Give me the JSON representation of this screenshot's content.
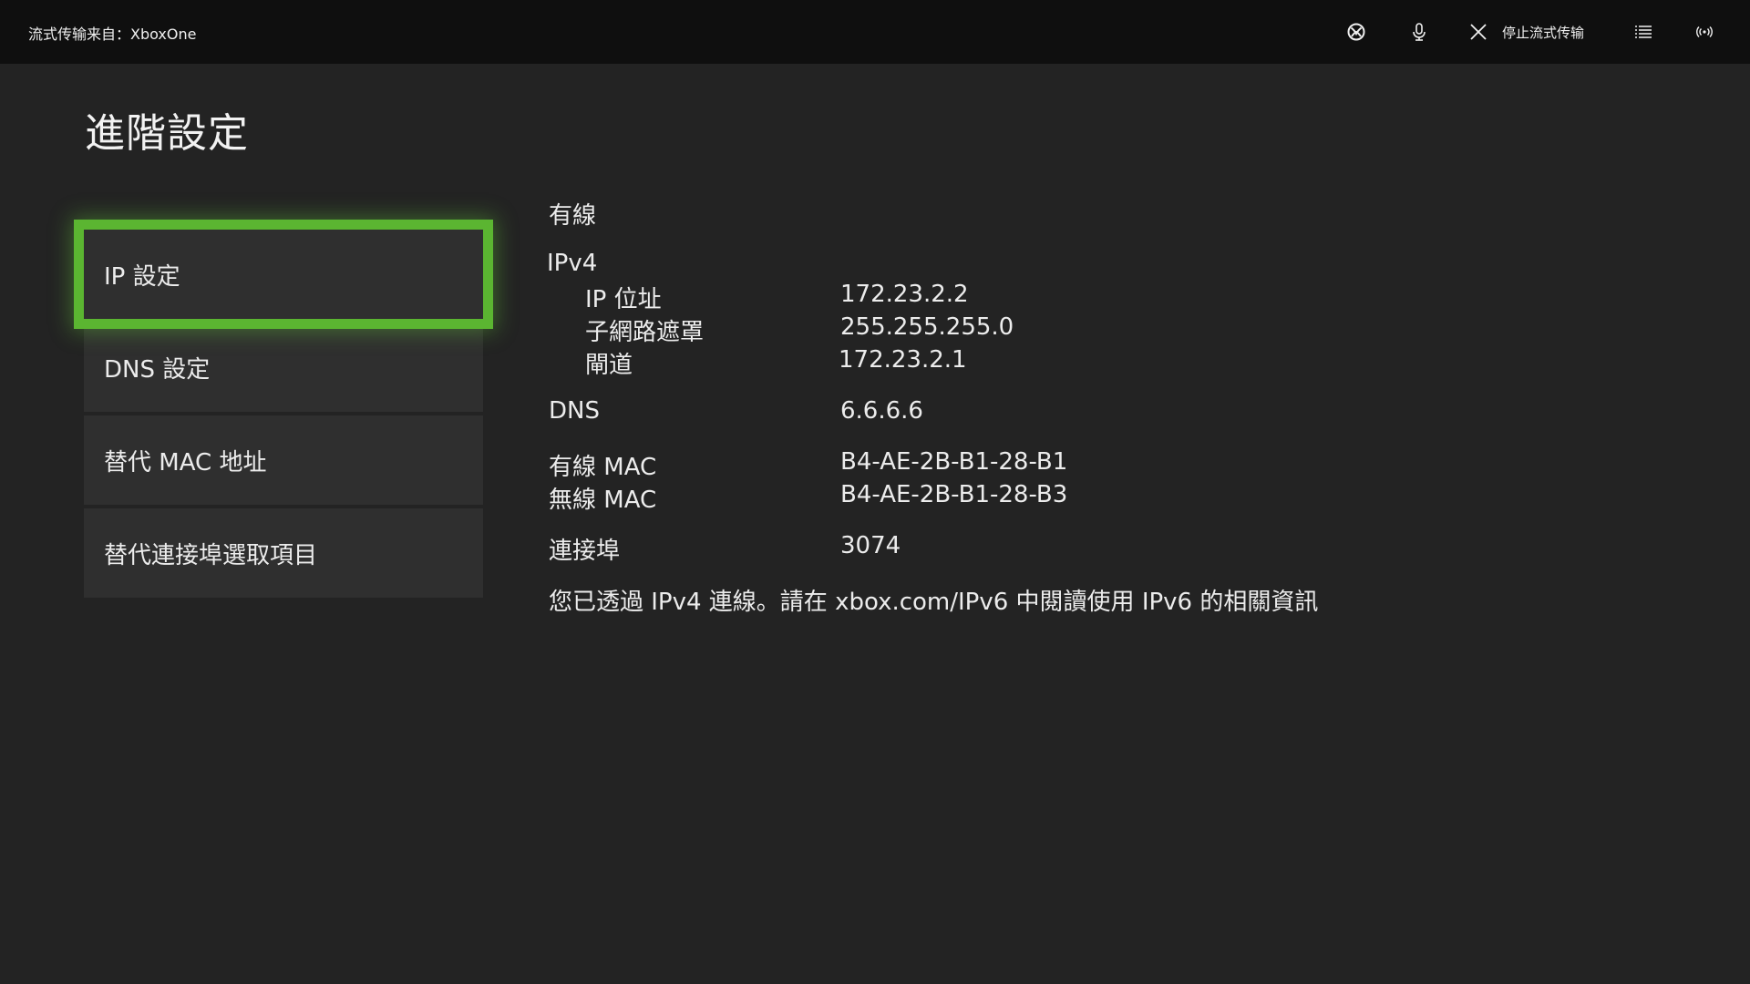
{
  "topbar": {
    "stream_source": "流式传输来自：XboxOne",
    "stop_label": "停止流式传输",
    "icons": [
      "xbox-icon",
      "microphone-icon",
      "close-icon",
      "menu-list-icon",
      "broadcast-icon"
    ]
  },
  "page": {
    "title": "進階設定"
  },
  "menu": {
    "items": [
      {
        "label": "IP 設定"
      },
      {
        "label": "DNS 設定"
      },
      {
        "label": "替代 MAC 地址"
      },
      {
        "label": "替代連接埠選取項目"
      }
    ],
    "selected_index": 0
  },
  "details": {
    "connection_type": "有線",
    "ipv4_heading": "IPv4",
    "ip_address_label": "IP 位址",
    "ip_address_value": "172.23.2.2",
    "subnet_label": "子網路遮罩",
    "subnet_value": "255.255.255.0",
    "gateway_label": "閘道",
    "gateway_value": "172.23.2.1",
    "dns_label": "DNS",
    "dns_value": "6.6.6.6",
    "wired_mac_label": "有線 MAC",
    "wired_mac_value": "B4-AE-2B-B1-28-B1",
    "wireless_mac_label": "無線 MAC",
    "wireless_mac_value": "B4-AE-2B-B1-28-B3",
    "port_label": "連接埠",
    "port_value": "3074",
    "note": "您已透過 IPv4 連線。請在 xbox.com/IPv6 中閱讀使用 IPv6 的相關資訊"
  },
  "colors": {
    "background": "#232323",
    "topbar": "#0f0f0f",
    "accent_green": "#5bb531",
    "menu_item_bg": "#2f2f2f"
  }
}
